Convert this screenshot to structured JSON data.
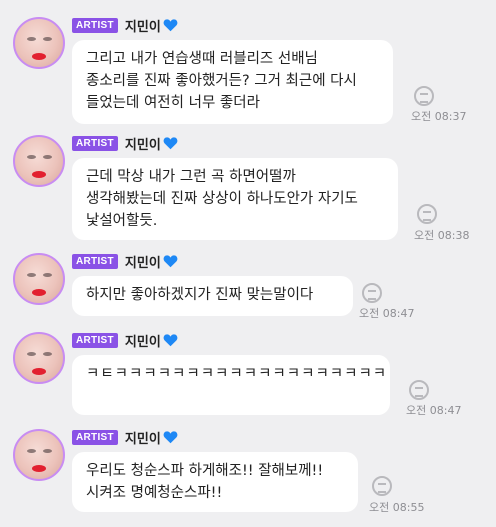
{
  "messages": [
    {
      "badge": "ARTIST",
      "sender": "지민이",
      "text": "그리고 내가 연습생때 러블리즈 선배님\n종소리를 진짜 좋아했거든? 그거 최근에 다시\n들었는데 여전히 너무 좋더라",
      "time": "오전 08:37"
    },
    {
      "badge": "ARTIST",
      "sender": "지민이",
      "text": "근데 막상 내가 그런 곡 하면어떨까\n생각해봤는데 진짜 상상이 하나도안가 자기도\n낯설어할듯.",
      "time": "오전 08:38"
    },
    {
      "badge": "ARTIST",
      "sender": "지민이",
      "text": "하지만 좋아하겠지가 진짜 맞는말이다",
      "time": "오전 08:47"
    },
    {
      "badge": "ARTIST",
      "sender": "지민이",
      "text": "ㅋㅌㅋㅋㅋㅋㅋㅋㅋㅋㅋㅋㅋㅋㅋㅋㅋㅋㅋㅋㅋ\nㅋㅋㅋㅋㅋㅋㅋ",
      "time": "오전 08:47"
    },
    {
      "badge": "ARTIST",
      "sender": "지민이",
      "text": "우리도 청순스파 하게해조!! 잘해보께!!\n시켜조 명예청순스파!!",
      "time": "오전 08:55"
    }
  ],
  "colors": {
    "background": "#efeff1",
    "badge": "#8a52e6",
    "avatar_border": "#c88cf2",
    "heart": "#1e88f5"
  },
  "icons": {
    "heart": "blue-heart-icon",
    "translate": "translate-icon"
  }
}
